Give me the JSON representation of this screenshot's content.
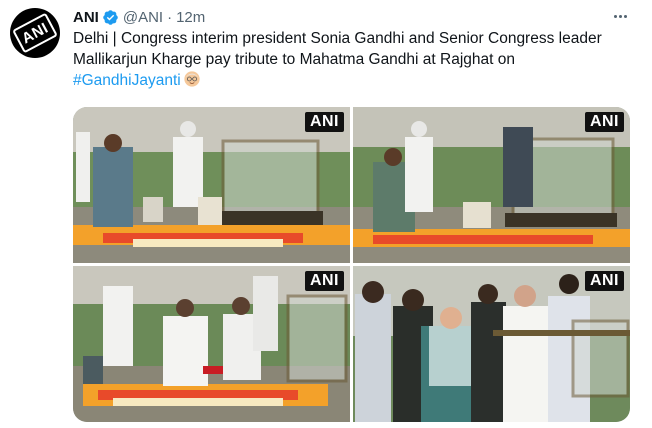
{
  "tweet": {
    "author": {
      "name": "ANI",
      "handle": "@ANI",
      "time": "12m",
      "avatar_text": "ANI"
    },
    "text_main": "Delhi | Congress interim president Sonia Gandhi and Senior Congress leader Mallikarjun Kharge pay tribute to Mahatma Gandhi at Rajghat on",
    "hashtag": "#GandhiJayanti",
    "emoji": "old-man-emoji",
    "media": {
      "photos": [
        {
          "watermark": "ANI"
        },
        {
          "watermark": "ANI"
        },
        {
          "watermark": "ANI"
        },
        {
          "watermark": "ANI"
        }
      ]
    }
  },
  "colors": {
    "accent": "#1d9bf0",
    "text": "#0f1419",
    "muted": "#536471"
  }
}
